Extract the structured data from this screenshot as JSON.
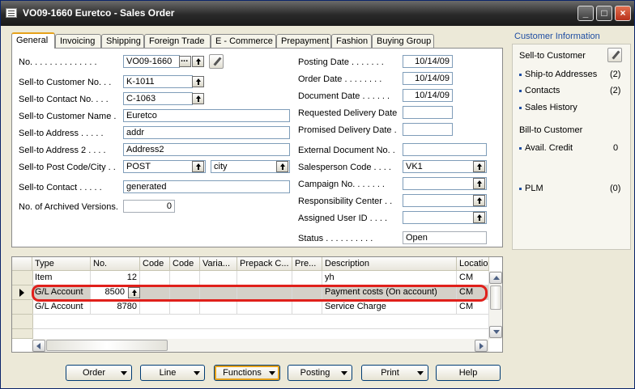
{
  "window": {
    "title": "VO09-1660 Euretco - Sales Order"
  },
  "tabs": [
    "General",
    "Invoicing",
    "Shipping",
    "Foreign Trade",
    "E - Commerce",
    "Prepayment",
    "Fashion",
    "Buying Group"
  ],
  "general": {
    "left": [
      {
        "label": "No. . . . . . . . . . . . . .",
        "value": "VO09-1660"
      },
      {
        "label": "Sell-to Customer No. . .",
        "value": "K-1011"
      },
      {
        "label": "Sell-to Contact No. . . .",
        "value": "C-1063"
      },
      {
        "label": "Sell-to Customer Name .",
        "value": "Euretco"
      },
      {
        "label": "Sell-to Address . . . . .",
        "value": "addr"
      },
      {
        "label": "Sell-to Address 2 . . . .",
        "value": "Address2"
      },
      {
        "label": "Sell-to Post Code/City . .",
        "value": "POST",
        "value2": "city"
      },
      {
        "label": "Sell-to Contact . . . . .",
        "value": "generated"
      },
      {
        "label": "No. of Archived Versions.",
        "value": "0"
      }
    ],
    "right": [
      {
        "label": "Posting Date . . . . . . .",
        "value": "10/14/09"
      },
      {
        "label": "Order Date . . . . . . . .",
        "value": "10/14/09"
      },
      {
        "label": "Document Date . . . . . .",
        "value": "10/14/09"
      },
      {
        "label": "Requested Delivery Date",
        "value": ""
      },
      {
        "label": "Promised Delivery Date .",
        "value": ""
      },
      {
        "label": "External Document No. .",
        "value": ""
      },
      {
        "label": "Salesperson Code . . . .",
        "value": "VK1"
      },
      {
        "label": "Campaign No. . . . . . .",
        "value": ""
      },
      {
        "label": "Responsibility Center . .",
        "value": ""
      },
      {
        "label": "Assigned User ID . . . .",
        "value": ""
      },
      {
        "label": "Status . . . . . . . . . .",
        "value": "Open"
      }
    ]
  },
  "side": {
    "header": "Customer Information",
    "sell_to": "Sell-to Customer",
    "links": [
      {
        "label": "Ship-to Addresses",
        "value": "(2)"
      },
      {
        "label": "Contacts",
        "value": "(2)"
      },
      {
        "label": "Sales History",
        "value": ""
      }
    ],
    "bill_to": "Bill-to Customer",
    "avail_credit": {
      "label": "Avail. Credit",
      "value": "0"
    },
    "plm": {
      "label": "PLM",
      "value": "(0)"
    }
  },
  "lines": {
    "columns": [
      "Type",
      "No.",
      "Code",
      "Code",
      "Varia...",
      "Prepack C...",
      "Pre...",
      "Description",
      "Locatio"
    ],
    "rows": [
      {
        "type": "Item",
        "no": "12",
        "description": "yh",
        "location": "CM"
      },
      {
        "type": "G/L Account",
        "no": "8500",
        "description": "Payment costs (On account)",
        "location": "CM"
      },
      {
        "type": "G/L Account",
        "no": "8780",
        "description": "Service Charge",
        "location": "CM"
      }
    ]
  },
  "buttons": {
    "order": "Order",
    "line": "Line",
    "functions": "Functions",
    "posting": "Posting",
    "print": "Print",
    "help": "Help"
  },
  "colors": {
    "highlight_ring": "#e0201b",
    "link": "#1f4ea3",
    "focus": "#e6a21a"
  }
}
